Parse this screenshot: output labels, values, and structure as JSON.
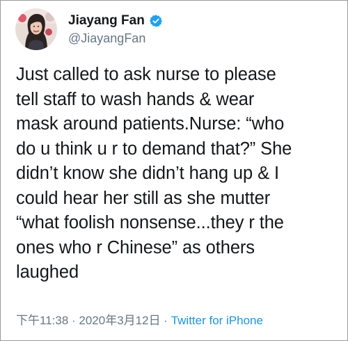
{
  "user": {
    "display_name": "Jiayang Fan",
    "handle": "@JiayangFan",
    "verified": true,
    "avatar": "profile-photo"
  },
  "tweet": {
    "text": "Just called to ask nurse to please\ntell staff to wash hands & wear\nmask around patients.Nurse: “who\ndo u think u r to demand that?” She\ndidn’t know she didn’t hang up & I\ncould hear her still as she mutter\n“what foolish nonsense...they r the\nones who r Chinese” as others\nlaughed"
  },
  "meta": {
    "time": "下午11:38",
    "separator1": " · ",
    "date": "2020年3月12日",
    "separator2": " · ",
    "source": "Twitter for iPhone"
  },
  "colors": {
    "text": "#14171a",
    "secondary": "#657786",
    "link": "#1b95e0",
    "verified": "#1da1f2",
    "border": "#9a9a9a"
  }
}
